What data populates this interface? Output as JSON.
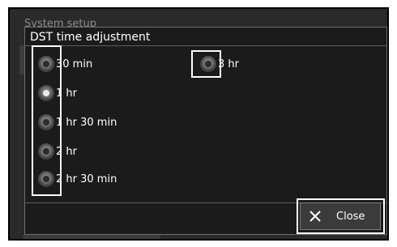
{
  "app": {
    "background_title": "System setup"
  },
  "dialog": {
    "title": "DST time adjustment",
    "options": [
      {
        "label": "30 min",
        "selected": false
      },
      {
        "label": "1 hr",
        "selected": true
      },
      {
        "label": "1 hr 30 min",
        "selected": false
      },
      {
        "label": "2 hr",
        "selected": false
      },
      {
        "label": "2 hr 30 min",
        "selected": false
      },
      {
        "label": "3 hr",
        "selected": false
      }
    ],
    "close_label": "Close"
  },
  "colors": {
    "dialog_background": "#1b1b1b",
    "text": "#ffffff",
    "callout_border": "#ffffff",
    "button_background": "#3b3b3b"
  },
  "icons": {
    "close": "close-icon",
    "radio": "radio-icon"
  }
}
